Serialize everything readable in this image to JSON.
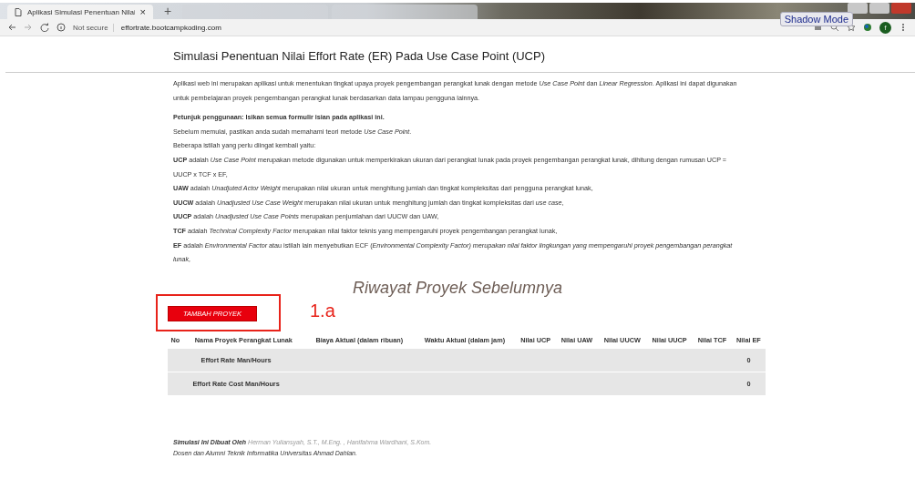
{
  "browser": {
    "tabs": [
      {
        "title": "Aplikasi Simulasi Penentuan Nilai",
        "selected": true,
        "close": "×"
      },
      {
        "selected": false
      },
      {
        "selected": false
      }
    ],
    "new_tab": "+",
    "address": {
      "security": "Not secure",
      "url": "effortrate.bootcampkoding.com"
    },
    "tooltip": "Shadow Mode",
    "profile": "f"
  },
  "page": {
    "title": "Simulasi Penentuan Nilai Effort Rate (ER) Pada Use Case Point (UCP)",
    "intro": "Aplikasi web ini merupakan aplikasi untuk menentukan tingkat upaya proyek pengembangan perangkat lunak dengan metode *Use Case Point* dan *Linear Regression*. Aplikasi ini dapat digunakan untuk pembelajaran proyek pengembangan perangkat lunak berdasarkan data lampau pengguna lainnya.",
    "instructions": [
      "**Petunjuk penggunaan: Isikan semua formulir isian pada aplikasi ini.**",
      "Sebelum memulai, pastikan anda sudah memahami teori metode *Use Case Point*.",
      "Beberapa istilah yang perlu diingat kembali yaitu:",
      "**UCP** adalah *Use Case Point* merupakan metode digunakan untuk memperkirakan ukuran dari perangkat lunak pada proyek pengembangan perangkat lunak, dihitung dengan rumusan UCP = UUCP x TCF x EF,",
      "**UAW** adalah *Unadjuted Actor Weight* merupakan nilai ukuran untuk menghitung jumlah dan tingkat kompleksitas dari pengguna perangkat lunak,",
      "**UUCW** adalah *Unadjusted Use Case Weight* merupakan nilai ukuran untuk menghitung jumlah dan tingkat kompleksitas dari *use case*,",
      "**UUCP** adalah *Unadjusted Use Case Points* merupakan penjumlahan dari UUCW dan UAW,",
      "**TCF** adalah *Technical Complexity Factor* merupakan nilai faktor teknis yang mempengaruhi proyek pengembangan perangkat lunak,",
      "**EF** adalah *Environmental Factor* atau istilah lain menyebutkan ECF (*Environmental Complexity Factor) merupakan nilai faktor lingkungan yang mempengaruhi proyek pengembangan perangkat lunak,*"
    ],
    "history_title": "Riwayat Proyek Sebelumnya",
    "add_button": "TAMBAH PROYEK",
    "annotation": "1.a",
    "table": {
      "columns": [
        "No",
        "Nama Proyek Perangkat Lunak",
        "Biaya Aktual (dalam ribuan)",
        "Waktu Aktual (dalam jam)",
        "Nilai UCP",
        "Nilai UAW",
        "Nilai UUCW",
        "Nilai UUCP",
        "Nilai TCF",
        "Nilai EF"
      ],
      "rows": [
        {
          "label": "Effort Rate Man/Hours",
          "value": "0"
        },
        {
          "label": "Effort Rate Cost Man/Hours",
          "value": "0"
        }
      ]
    },
    "footer": {
      "credit_label": "Simulasi Ini Dibuat Oleh",
      "authors": "Herman Yuliansyah, S.T., M.Eng. , Hanifahma Wardhani, S.Kom.",
      "affiliation": "Dosen dan Alumni Teknik Informatika Universitas Ahmad Dahlan."
    }
  }
}
